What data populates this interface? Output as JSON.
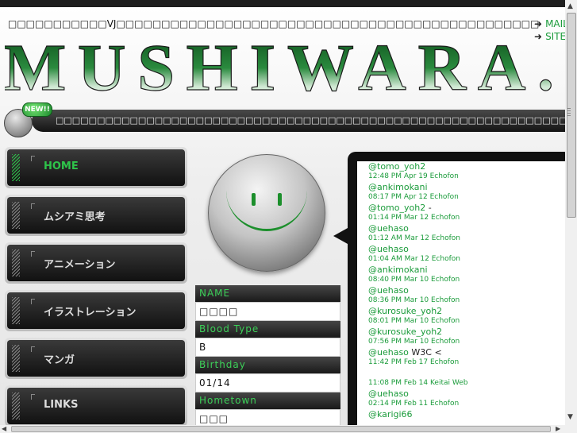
{
  "header": {
    "tagline": "□□□□□□□□□□□VJ□□□□□□□□□□□□□□□□□□□□□□□□□□□□□□□□□□□□□□□□□□□□□□□",
    "links": [
      "MAIL",
      "SITE"
    ],
    "logo_text": "MUSHIWARA.BI"
  },
  "news": {
    "badge": "NEW!!",
    "text": "□□□□□□□□□□□□□□□□□□□□□□□□□□□□□□□□□□□□□□□□□□□□□□□□□□□□□□□□□□□□□□□□□□□□"
  },
  "nav": {
    "items": [
      {
        "label": "HOME",
        "active": true
      },
      {
        "label": "ムシアミ思考"
      },
      {
        "label": "アニメーション"
      },
      {
        "label": "イラストレーション"
      },
      {
        "label": "マンガ"
      },
      {
        "label": "LINKS"
      }
    ]
  },
  "profile": {
    "fields": [
      {
        "label": "NAME",
        "value": "□□□□"
      },
      {
        "label": "Blood Type",
        "value": "B"
      },
      {
        "label": "Birthday",
        "value": "01/14"
      },
      {
        "label": "Hometown",
        "value": "□□□"
      }
    ]
  },
  "tweets": [
    {
      "user": "@tomo_yoh2",
      "text": "",
      "meta": "12:48 PM Apr 19 Echofon"
    },
    {
      "user": "@ankimokani",
      "text": "",
      "meta": "08:17 PM Apr 12 Echofon"
    },
    {
      "user": "@tomo_yoh2",
      "text": " -",
      "meta": "01:14 PM Mar 12 Echofon"
    },
    {
      "user": "@uehaso",
      "text": "",
      "meta": "01:12 AM Mar 12 Echofon"
    },
    {
      "user": "@uehaso",
      "text": "",
      "meta": "01:04 AM Mar 12 Echofon"
    },
    {
      "user": "@ankimokani",
      "text": "",
      "meta": "08:40 PM Mar 10 Echofon"
    },
    {
      "user": "@uehaso",
      "text": "",
      "meta": "08:36 PM Mar 10 Echofon"
    },
    {
      "user": "@kurosuke_yoh2",
      "text": "",
      "meta": "08:01 PM Mar 10 Echofon"
    },
    {
      "user": "@kurosuke_yoh2",
      "text": "",
      "meta": "07:56 PM Mar 10 Echofon"
    },
    {
      "user": "@uehaso",
      "text": " W3C <",
      "meta": "11:42 PM Feb 17 Echofon"
    },
    {
      "user": "",
      "text": "",
      "meta": "11:08 PM Feb 14 Keitai Web"
    },
    {
      "user": "@uehaso",
      "text": "",
      "meta": "02:14 PM Feb 11 Echofon"
    },
    {
      "user": "@karigi66",
      "text": "",
      "meta": ""
    }
  ],
  "colors": {
    "accent": "#1a9b3a",
    "dark": "#1a1a1a"
  }
}
